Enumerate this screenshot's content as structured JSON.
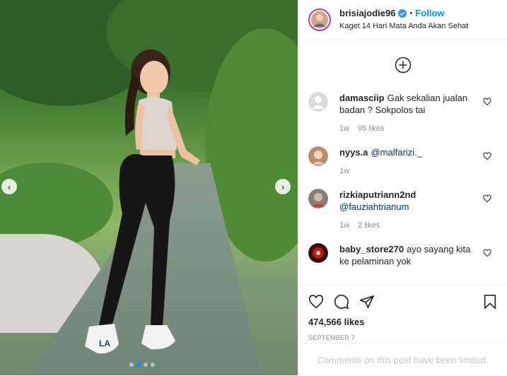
{
  "post": {
    "username": "brisiajodie96",
    "separator": "•",
    "follow_label": "Follow",
    "location": "Kaget 14 Hari Mata Anda Akan Sehat"
  },
  "media": {
    "prev_icon": "chevron-left-icon",
    "next_icon": "chevron-right-icon",
    "slide_count": 4,
    "active_slide": 2
  },
  "comments": [
    {
      "user": "damasciip",
      "text": "Gak sekalian jualan badan ? Sokpolos tai",
      "mention": "",
      "time": "1w",
      "likes": "95 likes"
    },
    {
      "user": "nyys.a",
      "text": "",
      "mention": "@malfarizi._",
      "time": "1w",
      "likes": ""
    },
    {
      "user": "rizkiaputriann2nd",
      "text": "",
      "mention": "@fauziahtrianum",
      "time": "1w",
      "likes": "2 likes"
    },
    {
      "user": "baby_store270",
      "text": "ayo sayang kita ke pelaminan yok",
      "mention": "",
      "time": "",
      "likes": ""
    }
  ],
  "actions": {
    "likes_count": "474,566 likes",
    "date": "SEPTEMBER 7"
  },
  "footer": {
    "limited_text": "Comments on this post have been limited."
  },
  "colors": {
    "accent": "#0095f6",
    "muted": "#8e8e8e",
    "border": "#efefef"
  }
}
